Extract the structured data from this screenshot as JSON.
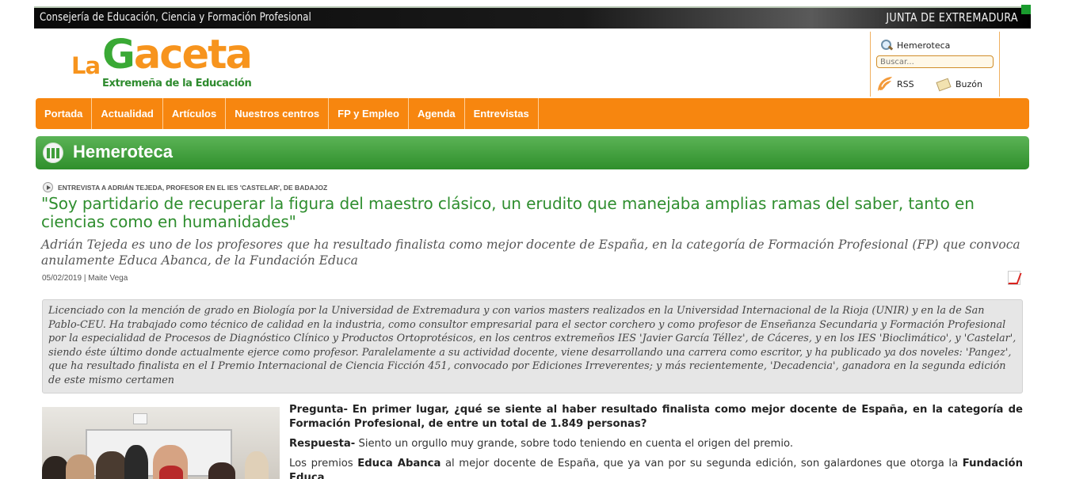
{
  "topbar": {
    "left_title": "Consejería de Educación, Ciencia y Formación Profesional",
    "right_title": "JUNTA DE EXTREMADURA"
  },
  "logo": {
    "la": "La",
    "gaceta_g": "G",
    "gaceta_rest": "aceta",
    "subtitle": "Extremeña de la Educación"
  },
  "util": {
    "hemeroteca": "Hemeroteca",
    "search_placeholder": "Buscar...",
    "rss": "RSS",
    "buzon": "Buzón"
  },
  "nav": {
    "items": [
      "Portada",
      "Actualidad",
      "Artículos",
      "Nuestros centros",
      "FP y Empleo",
      "Agenda",
      "Entrevistas"
    ]
  },
  "section": {
    "title": "Hemeroteca"
  },
  "article": {
    "kicker": "ENTREVISTA A ADRIÁN TEJEDA, PROFESOR EN EL IES 'CASTELAR', DE BADAJOZ",
    "headline": "\"Soy partidario de recuperar la figura del maestro clásico, un erudito que manejaba amplias ramas del saber, tanto en ciencias como en humanidades\"",
    "subtitle": "Adrián Tejeda es uno de los profesores que ha resultado finalista como mejor docente de España, en la categoría de Formación Profesional (FP) que convoca anulamente Educa Abanca, de la Fundación Educa",
    "date": "05/02/2019",
    "separator": "|",
    "author": "Maite Vega",
    "bio": "Licenciado con la mención de grado en Biología por la Universidad de Extremadura y con varios masters realizados en la Universidad Internacional de la Rioja (UNIR) y en la de San Pablo-CEU. Ha trabajado como técnico de calidad en la industria, como consultor empresarial para el sector corchero y como profesor de Enseñanza Secundaria y Formación Profesional por la especialidad de Procesos de Diagnóstico Clínico y Productos Ortoprotésicos, en los centros extremeños IES 'Javier García Téllez', de Cáceres, y en los IES 'Bioclimático', y 'Castelar', siendo éste último donde actualmente ejerce como profesor. Paralelamente a su actividad docente, viene desarrollando una carrera como escritor, y ha publicado ya dos noveles: 'Pangez', que ha resultado finalista en el I Premio Internacional de Ciencia Ficción 451, convocado por Ediciones Irreverentes; y más recientemente, 'Decadencia', ganadora en la segunda edición de este mismo certamen",
    "q1_label": "Pregunta-",
    "q1_text": "En primer lugar, ¿qué se siente al haber resultado finalista como mejor docente de España, en la categoría de Formación Profesional, de entre un total de 1.849 personas?",
    "a1_label": "Respuesta-",
    "a1_text": "Siento un orgullo muy grande, sobre todo teniendo en cuenta el origen del premio.",
    "p2_a": "Los premios ",
    "p2_b": "Educa Abanca",
    "p2_c": " al mejor docente de España, que ya van por su segunda edición, son galardones que otorga la ",
    "p2_d": "Fundación Educa"
  },
  "colors": {
    "orange": "#f7860f",
    "green": "#2f8e2f"
  }
}
